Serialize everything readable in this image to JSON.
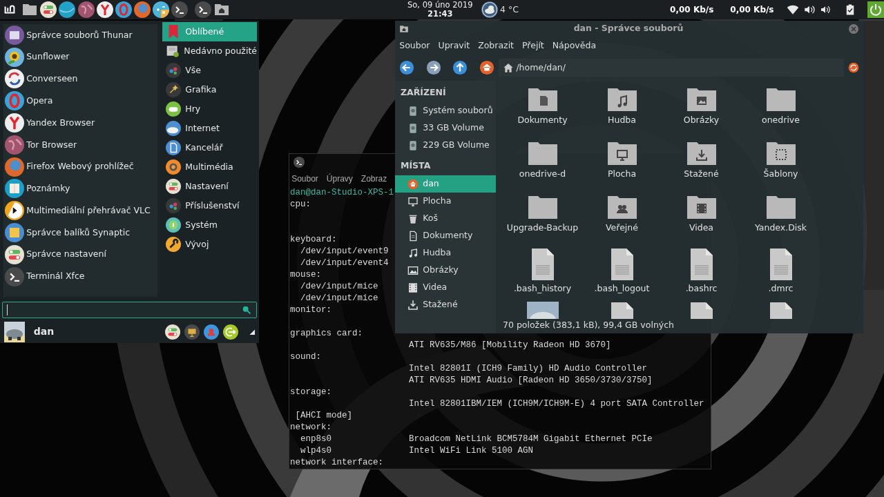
{
  "top_panel": {
    "clock": {
      "date": "So, 09 úno 2019",
      "time": "21:43"
    },
    "weather": {
      "temperature": "4 °C"
    },
    "network": [
      "0,00 Kb/s",
      "0,00 Kb/s"
    ]
  },
  "app_menu": {
    "favorites": [
      "Správce souborů Thunar",
      "Sunflower",
      "Converseen",
      "Opera",
      "Yandex Browser",
      "Tor Browser",
      "Firefox Webový prohlížeč",
      "Poznámky",
      "Multimediální přehrávač VLC",
      "Správce balíků Synaptic",
      "Správce nastavení",
      "Terminál Xfce"
    ],
    "categories": [
      {
        "label": "Oblíbené",
        "selected": true
      },
      {
        "label": "Nedávno použité",
        "selected": false
      },
      {
        "label": "Vše",
        "selected": false
      },
      {
        "label": "Grafika",
        "selected": false
      },
      {
        "label": "Hry",
        "selected": false
      },
      {
        "label": "Internet",
        "selected": false
      },
      {
        "label": "Kancelář",
        "selected": false
      },
      {
        "label": "Multimédia",
        "selected": false
      },
      {
        "label": "Nastavení",
        "selected": false
      },
      {
        "label": "Příslušenství",
        "selected": false
      },
      {
        "label": "Systém",
        "selected": false
      },
      {
        "label": "Vývoj",
        "selected": false
      }
    ],
    "user": {
      "name": "dan"
    }
  },
  "terminal": {
    "menu": [
      "Soubor",
      "Úpravy",
      "Zobraz"
    ],
    "lines": [
      {
        "kind": "prompt",
        "text": "dan@dan-Studio-XPS-1"
      },
      {
        "kind": "output",
        "text": "cpu:"
      },
      {
        "kind": "blank"
      },
      {
        "kind": "blank"
      },
      {
        "kind": "output",
        "text": "keyboard:"
      },
      {
        "kind": "output",
        "text": "  /dev/input/event9"
      },
      {
        "kind": "output",
        "text": "  /dev/input/event4"
      },
      {
        "kind": "output",
        "text": "mouse:"
      },
      {
        "kind": "output",
        "text": "  /dev/input/mice"
      },
      {
        "kind": "output",
        "text": "  /dev/input/mice"
      },
      {
        "kind": "output",
        "text": "monitor:"
      },
      {
        "kind": "blank"
      },
      {
        "kind": "output",
        "text": "graphics card:"
      },
      {
        "kind": "output",
        "detail": "ATI RV635/M86 [Mobility Radeon HD 3670]"
      },
      {
        "kind": "output",
        "text": "sound:"
      },
      {
        "kind": "output",
        "detail": "Intel 82801I (ICH9 Family) HD Audio Controller"
      },
      {
        "kind": "output",
        "detail": "ATI RV635 HDMI Audio [Radeon HD 3650/3730/3750]"
      },
      {
        "kind": "output",
        "text": "storage:"
      },
      {
        "kind": "output",
        "detail": "Intel 82801IBM/IEM (ICH9M/ICH9M-E) 4 port SATA Controller"
      },
      {
        "kind": "output",
        "text": " [AHCI mode]"
      },
      {
        "kind": "output",
        "text": "network:"
      },
      {
        "kind": "output",
        "text": "  enp8s0",
        "detail": "Broadcom NetLink BCM5784M Gigabit Ethernet PCIe"
      },
      {
        "kind": "output",
        "text": "  wlp4s0",
        "detail": "Intel WiFi Link 5100 AGN"
      },
      {
        "kind": "output",
        "text": "network interface:"
      }
    ]
  },
  "file_manager": {
    "title": "dan - Správce souborů",
    "menu": [
      "Soubor",
      "Upravit",
      "Zobrazit",
      "Přejít",
      "Nápověda"
    ],
    "path": "/home/dan/",
    "sidebar": [
      {
        "heading": "ZAŘÍZENÍ",
        "items": [
          {
            "label": "Systém souborů",
            "selected": false
          },
          {
            "label": "33 GB Volume",
            "selected": false
          },
          {
            "label": "229 GB Volume",
            "selected": false
          }
        ]
      },
      {
        "heading": "MÍSTA",
        "items": [
          {
            "label": "dan",
            "selected": true
          },
          {
            "label": "Plocha",
            "selected": false
          },
          {
            "label": "Koš",
            "selected": false
          },
          {
            "label": "Dokumenty",
            "selected": false
          },
          {
            "label": "Hudba",
            "selected": false
          },
          {
            "label": "Obrázky",
            "selected": false
          },
          {
            "label": "Videa",
            "selected": false
          },
          {
            "label": "Stažené",
            "selected": false
          }
        ]
      }
    ],
    "files": [
      {
        "kind": "folder",
        "label": "Dokumenty"
      },
      {
        "kind": "folder",
        "label": "Hudba"
      },
      {
        "kind": "folder",
        "label": "Obrázky"
      },
      {
        "kind": "folder",
        "label": "onedrive"
      },
      {
        "kind": "folder",
        "label": "onedrive-d"
      },
      {
        "kind": "folder",
        "label": "Plocha"
      },
      {
        "kind": "folder",
        "label": "Stažené"
      },
      {
        "kind": "folder",
        "label": "Šablony"
      },
      {
        "kind": "folder",
        "label": "Upgrade-Backup"
      },
      {
        "kind": "folder",
        "label": "Veřejné"
      },
      {
        "kind": "folder",
        "label": "Videa"
      },
      {
        "kind": "folder",
        "label": "Yandex.Disk"
      },
      {
        "kind": "file",
        "label": ".bash_history"
      },
      {
        "kind": "file",
        "label": ".bash_logout"
      },
      {
        "kind": "file",
        "label": ".bashrc"
      },
      {
        "kind": "file",
        "label": ".dmrc"
      },
      {
        "kind": "picture"
      },
      {
        "kind": "code"
      },
      {
        "kind": "file"
      },
      {
        "kind": "file"
      }
    ],
    "status": "70 položek (383,1 kB), 99,4 GB volných"
  }
}
